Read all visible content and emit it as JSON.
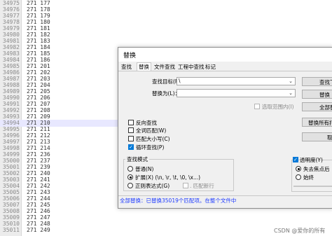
{
  "editor": {
    "lines": [
      {
        "n": "34975",
        "t": "271 177"
      },
      {
        "n": "34976",
        "t": "271 178"
      },
      {
        "n": "34977",
        "t": "271 179"
      },
      {
        "n": "34978",
        "t": "271 180"
      },
      {
        "n": "34979",
        "t": "271 181"
      },
      {
        "n": "34980",
        "t": "271 182"
      },
      {
        "n": "34981",
        "t": "271 183"
      },
      {
        "n": "34982",
        "t": "271 184"
      },
      {
        "n": "34983",
        "t": "271 185"
      },
      {
        "n": "34984",
        "t": "271 186"
      },
      {
        "n": "34985",
        "t": "271 201"
      },
      {
        "n": "34986",
        "t": "271 202"
      },
      {
        "n": "34987",
        "t": "271 203"
      },
      {
        "n": "34988",
        "t": "271 204"
      },
      {
        "n": "34989",
        "t": "271 205"
      },
      {
        "n": "34990",
        "t": "271 206"
      },
      {
        "n": "34991",
        "t": "271 207"
      },
      {
        "n": "34992",
        "t": "271 208"
      },
      {
        "n": "34993",
        "t": "271 209"
      },
      {
        "n": "34994",
        "t": "271 210"
      },
      {
        "n": "34995",
        "t": "271 211"
      },
      {
        "n": "34996",
        "t": "271 212"
      },
      {
        "n": "34997",
        "t": "271 213"
      },
      {
        "n": "34998",
        "t": "271 214"
      },
      {
        "n": "34999",
        "t": "271 236"
      },
      {
        "n": "35000",
        "t": "271 237"
      },
      {
        "n": "35001",
        "t": "271 239"
      },
      {
        "n": "35002",
        "t": "271 240"
      },
      {
        "n": "35003",
        "t": "271 241"
      },
      {
        "n": "35004",
        "t": "271 242"
      },
      {
        "n": "35005",
        "t": "271 243"
      },
      {
        "n": "35006",
        "t": "271 244"
      },
      {
        "n": "35007",
        "t": "271 245"
      },
      {
        "n": "35008",
        "t": "271 246"
      },
      {
        "n": "35009",
        "t": "271 247"
      },
      {
        "n": "35010",
        "t": "271 248"
      },
      {
        "n": "35011",
        "t": "271 249"
      }
    ],
    "highlight_index": 19
  },
  "dialog": {
    "title": "替换",
    "tabs": [
      "查找",
      "替换",
      "文件查找",
      "工程中查找",
      "标记"
    ],
    "active_tab": "替换",
    "find_label": "查找目标(F)：",
    "find_value": "\\",
    "replace_label": "替换为(L)：",
    "replace_value": "",
    "in_selection": "选取范围内(I)",
    "buttons": {
      "find_next": "查找下一个",
      "replace": "替换",
      "replace_all": "全部替换",
      "replace_all_open": "替换所有打开的文件",
      "close": "取消"
    },
    "options": {
      "backward": "反向查找",
      "whole_word": "全词匹配(W)",
      "match_case": "匹配大小写(C)",
      "wrap": "循环查找(P)"
    },
    "search_mode": {
      "title": "查找模式",
      "normal": "普通(N)",
      "extended": "扩展(X) (\\n, \\r, \\t, \\0, \\x...)",
      "regex": "正则表达式(G)",
      "dot_newline": ". 匹配新行"
    },
    "transparency": {
      "title": "透明度(Y)",
      "on_lose_focus": "失去焦点后",
      "always": "始终"
    },
    "status": "全部替换：已替换35019个匹配项。在整个文件中"
  },
  "watermark": "CSDN @爱你的所有"
}
